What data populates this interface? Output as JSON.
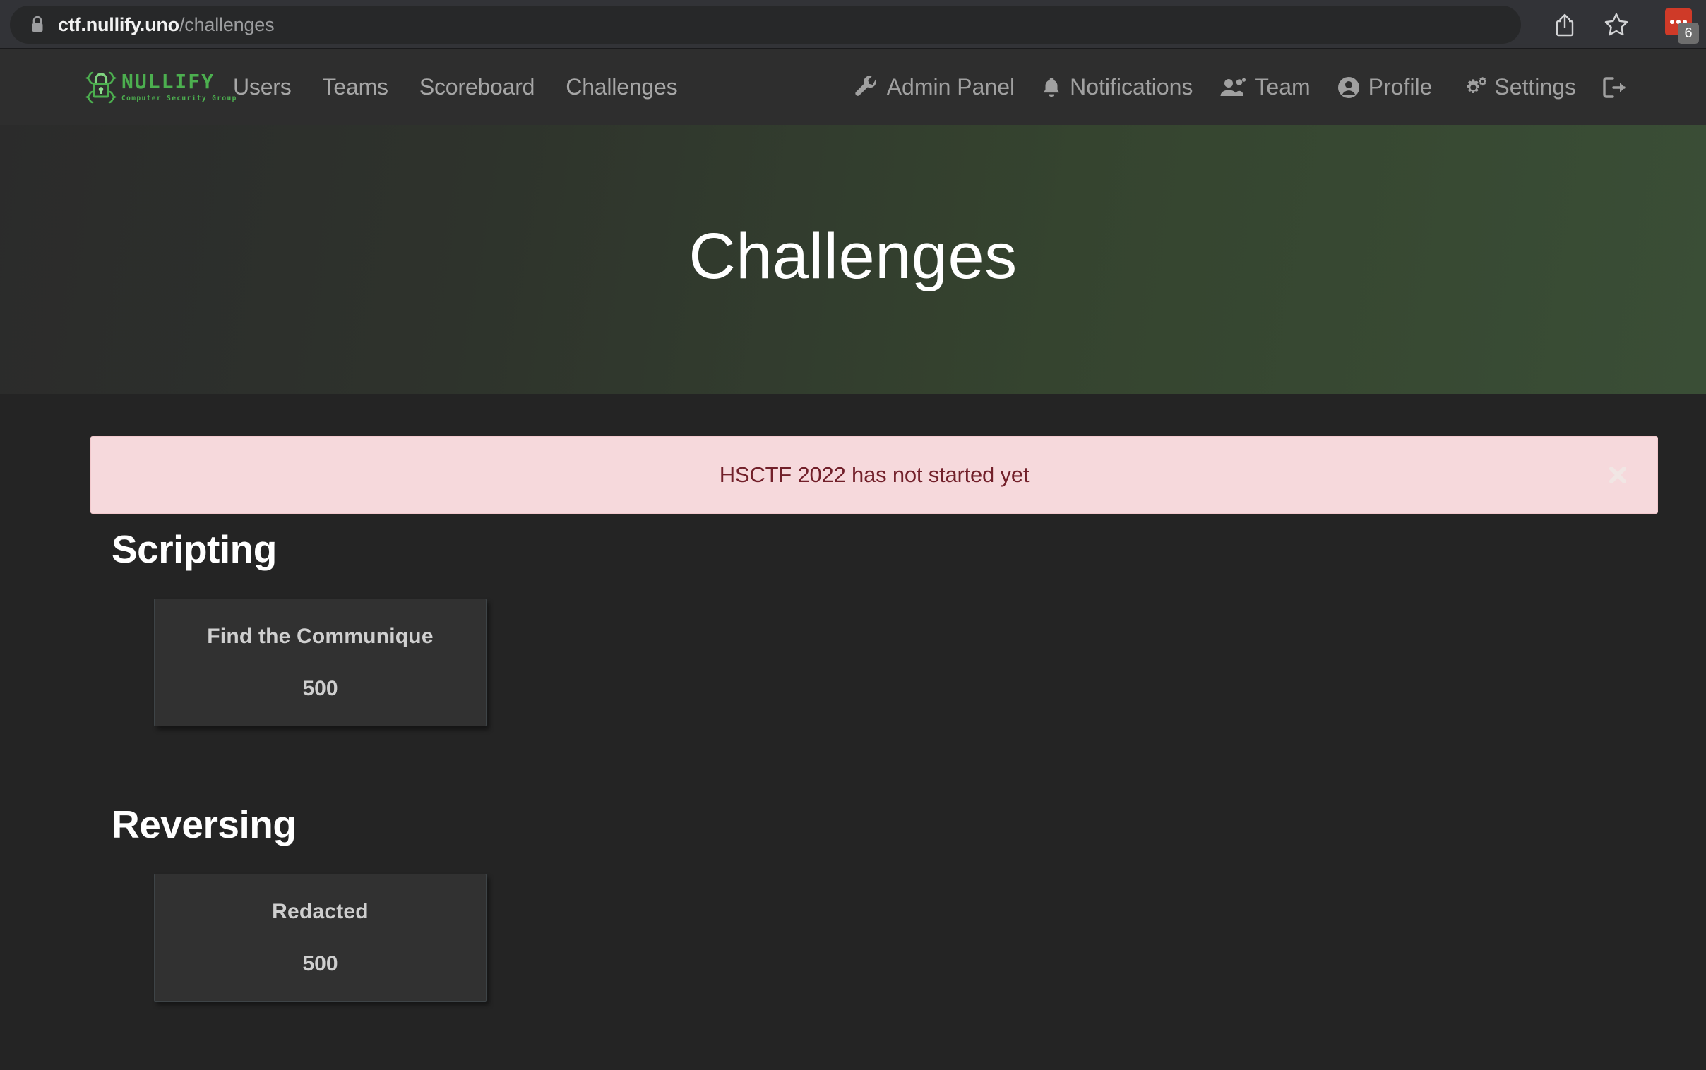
{
  "browser": {
    "url_host": "ctf.nullify.uno",
    "url_path": "/challenges",
    "lock_icon": "lock-icon",
    "share_icon": "share-icon",
    "bookmark_icon": "star-icon",
    "extension_icon": "extension-icon",
    "extension_badge_count": "6"
  },
  "navbar": {
    "brand": {
      "name": "NULLIFY",
      "tagline": "Computer Security Group",
      "logo_icon": "padlock-braces-logo-icon"
    },
    "links": [
      {
        "label": "Users"
      },
      {
        "label": "Teams"
      },
      {
        "label": "Scoreboard"
      },
      {
        "label": "Challenges"
      }
    ],
    "right_items": [
      {
        "label": "Admin Panel",
        "icon": "wrench-icon"
      },
      {
        "label": "Notifications",
        "icon": "bell-icon"
      },
      {
        "label": "Team",
        "icon": "users-icon"
      },
      {
        "label": "Profile",
        "icon": "user-circle-icon"
      },
      {
        "label": "Settings",
        "icon": "cogs-icon"
      },
      {
        "label": "",
        "icon": "sign-out-icon"
      }
    ]
  },
  "hero": {
    "title": "Challenges",
    "gradient_from": "#2b2b2b",
    "gradient_to": "#3a4e36"
  },
  "alert": {
    "message": "HSCTF 2022 has not started yet",
    "close_icon": "close-icon",
    "background": "#f6d9dc",
    "text_color": "#72202a"
  },
  "categories": [
    {
      "title": "Scripting",
      "challenges": [
        {
          "name": "Find the Communique",
          "points": "500"
        }
      ]
    },
    {
      "title": "Reversing",
      "challenges": [
        {
          "name": "Redacted",
          "points": "500"
        }
      ]
    }
  ]
}
